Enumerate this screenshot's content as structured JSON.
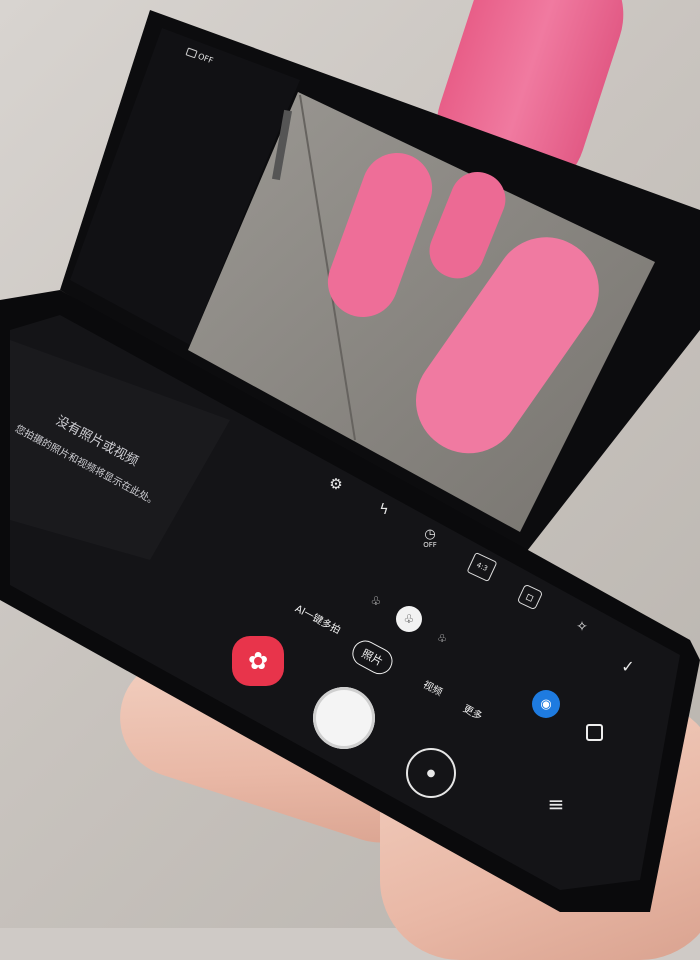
{
  "cover_screen": {
    "status_off_label": "OFF"
  },
  "gallery_panel": {
    "title": "没有照片或视频",
    "subtitle": "您拍摄的照片和视频将显示在此处。"
  },
  "camera": {
    "modes": {
      "single_take": "AI一键多拍",
      "photo": "照片",
      "video": "视频",
      "more": "更多"
    },
    "quick_settings": [
      "settings-icon",
      "flash-off-icon",
      "timer-off-icon",
      "ratio-4-3-icon",
      "motion-photo-icon",
      "filter-sparkle-icon"
    ],
    "ratio_label": "4:3",
    "timer_label": "OFF"
  },
  "colors": {
    "gallery_accent": "#e8344b",
    "bixby_blue": "#1e7be0",
    "subject_pink": "#ee6e98"
  }
}
